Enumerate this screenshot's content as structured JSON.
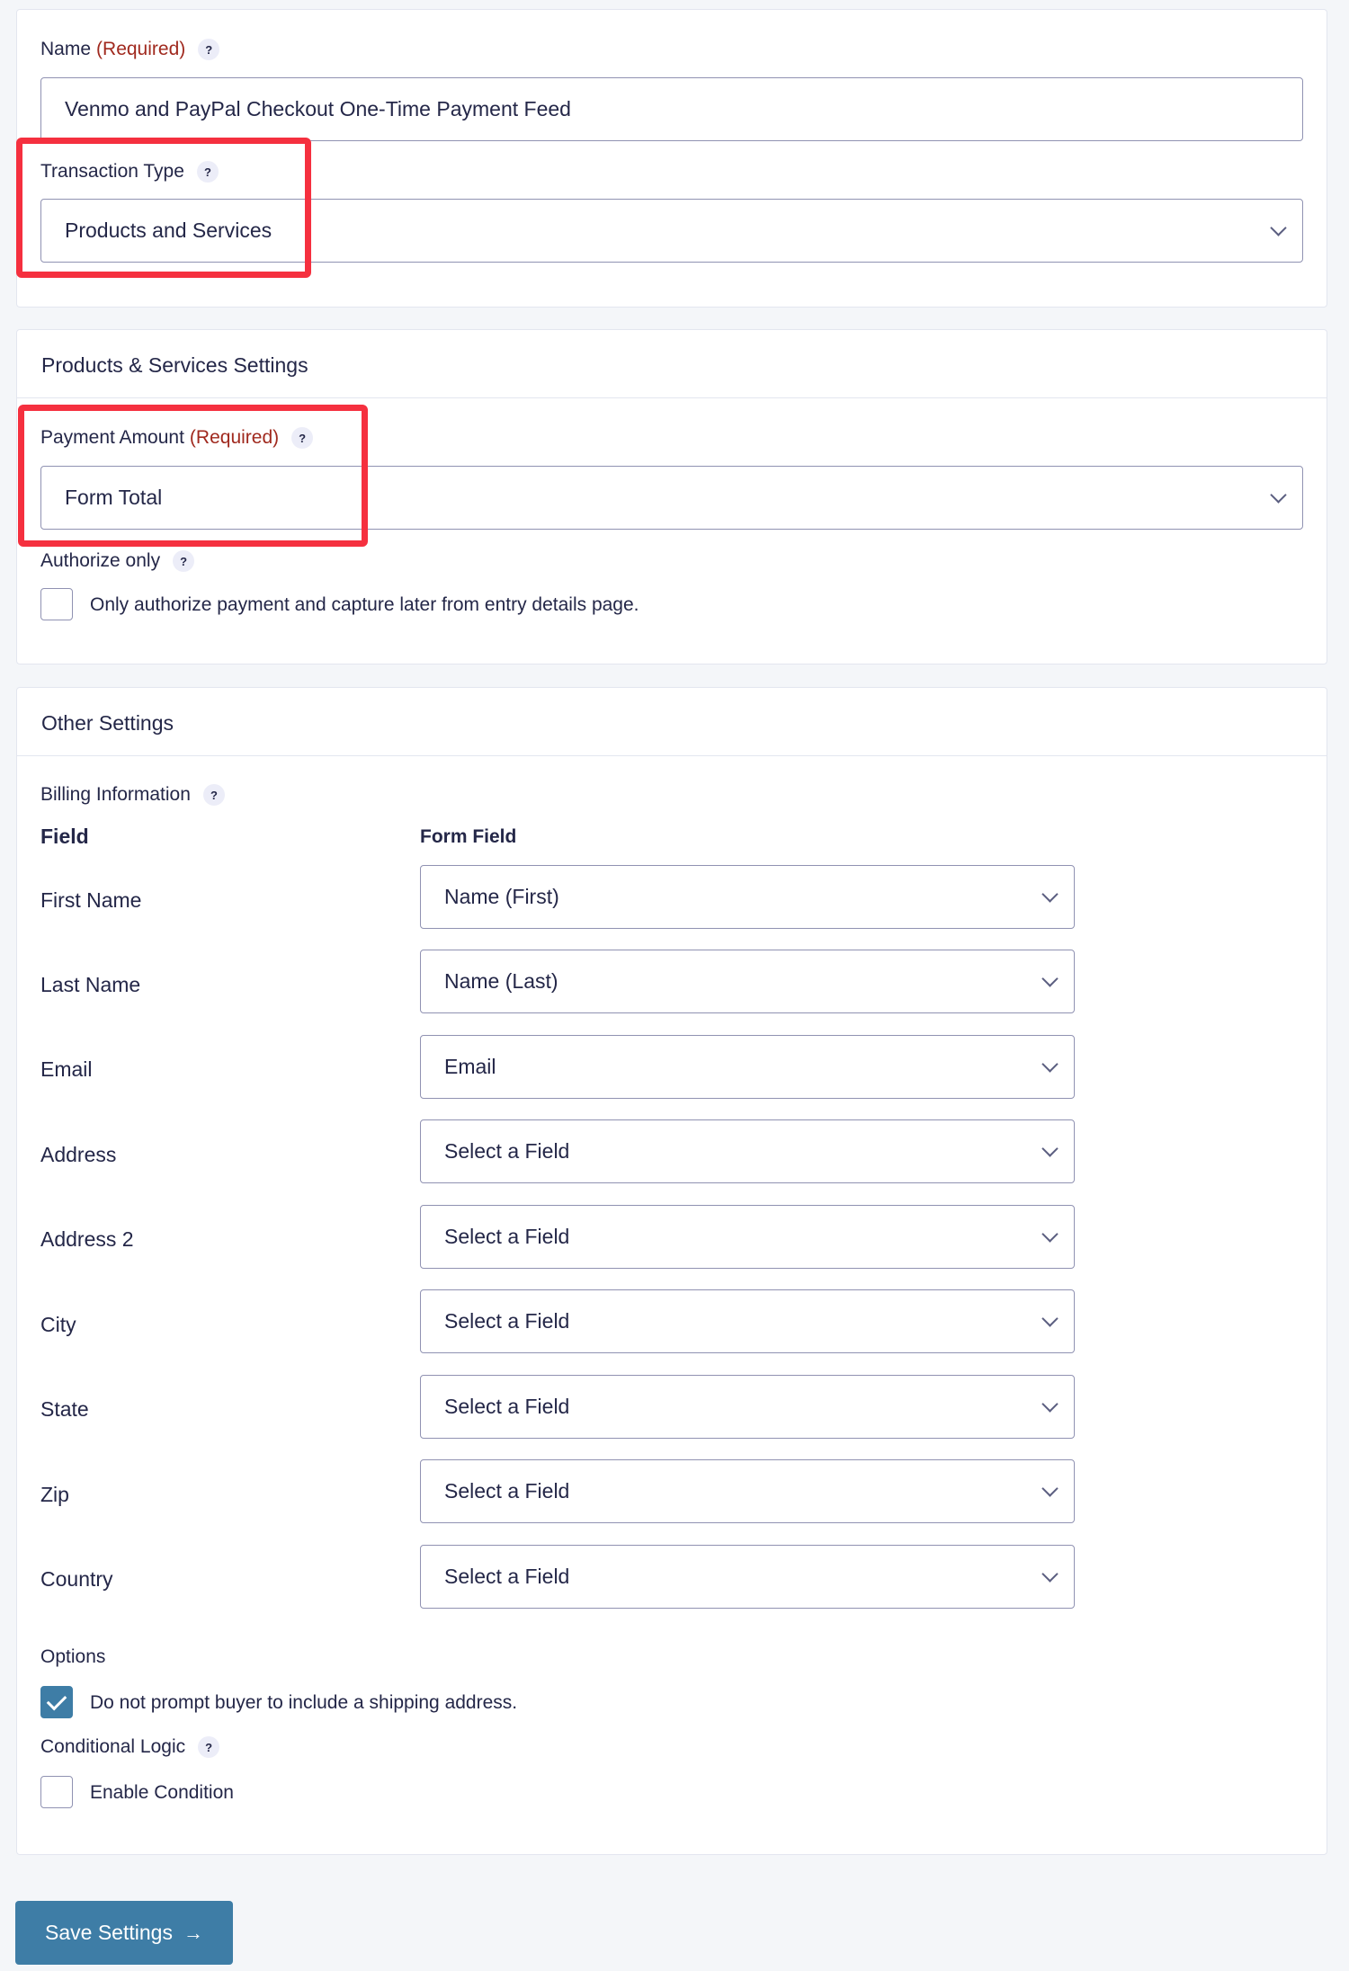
{
  "feed": {
    "name_label": "Name",
    "name_required": "(Required)",
    "name_help": "?",
    "name_value": "Venmo and PayPal Checkout One-Time Payment Feed",
    "transaction_type_label": "Transaction Type",
    "transaction_type_help": "?",
    "transaction_type_value": "Products and Services"
  },
  "products": {
    "title": "Products & Services Settings",
    "payment_amount_label": "Payment Amount",
    "payment_amount_required": "(Required)",
    "payment_amount_help": "?",
    "payment_amount_value": "Form Total",
    "authorize_label": "Authorize only",
    "authorize_help": "?",
    "authorize_checkbox_text": "Only authorize payment and capture later from entry details page.",
    "authorize_checked": false
  },
  "other": {
    "title": "Other Settings",
    "billing_label": "Billing Information",
    "billing_help": "?",
    "col_field": "Field",
    "col_form_field": "Form Field",
    "rows": [
      {
        "label": "First Name",
        "value": "Name (First)"
      },
      {
        "label": "Last Name",
        "value": "Name (Last)"
      },
      {
        "label": "Email",
        "value": "Email"
      },
      {
        "label": "Address",
        "value": "Select a Field"
      },
      {
        "label": "Address 2",
        "value": "Select a Field"
      },
      {
        "label": "City",
        "value": "Select a Field"
      },
      {
        "label": "State",
        "value": "Select a Field"
      },
      {
        "label": "Zip",
        "value": "Select a Field"
      },
      {
        "label": "Country",
        "value": "Select a Field"
      }
    ],
    "options_label": "Options",
    "shipping_text": "Do not prompt buyer to include a shipping address.",
    "shipping_checked": true,
    "conditional_label": "Conditional Logic",
    "conditional_help": "?",
    "condition_text": "Enable Condition",
    "condition_checked": false
  },
  "save": {
    "label": "Save Settings",
    "icon": "→"
  },
  "colors": {
    "accent": "#3e7da6",
    "required": "#a0291e",
    "highlight": "#f5303f"
  }
}
